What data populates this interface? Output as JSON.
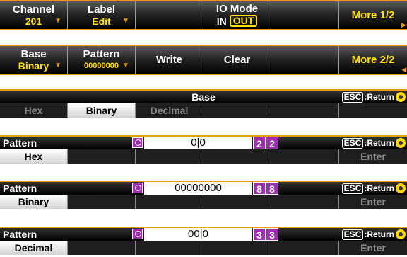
{
  "bar1": {
    "keys": [
      {
        "label": "Channel",
        "value": "201"
      },
      {
        "label": "Label",
        "value": "Edit"
      },
      {
        "label": ""
      },
      {
        "label": "IO Mode",
        "in": "IN",
        "out": "OUT"
      },
      {
        "label": ""
      },
      {
        "label": "More 1/2"
      }
    ]
  },
  "bar2": {
    "keys": [
      {
        "label": "Base",
        "value": "Binary"
      },
      {
        "label": "Pattern",
        "value": "00000000"
      },
      {
        "label": "Write"
      },
      {
        "label": "Clear"
      },
      {
        "label": ""
      },
      {
        "label": "More 2/2"
      }
    ]
  },
  "base_panel": {
    "title": "Base",
    "esc": "ESC",
    "return_label": ":Return",
    "options": [
      "Hex",
      "Binary",
      "Decimal"
    ],
    "selected": "Binary"
  },
  "pattern_panels": [
    {
      "title": "Pattern",
      "value": "0|0",
      "len_a": "2",
      "len_b": "2",
      "mode": "Hex",
      "enter": "Enter",
      "esc": "ESC",
      "return_label": ":Return"
    },
    {
      "title": "Pattern",
      "value": "00000000",
      "len_a": "8",
      "len_b": "8",
      "mode": "Binary",
      "enter": "Enter",
      "esc": "ESC",
      "return_label": ":Return"
    },
    {
      "title": "Pattern",
      "value": "00|0",
      "len_a": "3",
      "len_b": "3",
      "mode": "Decimal",
      "enter": "Enter",
      "esc": "ESC",
      "return_label": ":Return"
    }
  ],
  "colors": {
    "accent": "#e89a10",
    "highlight": "#ffe000",
    "purple": "#9b2fb0"
  }
}
